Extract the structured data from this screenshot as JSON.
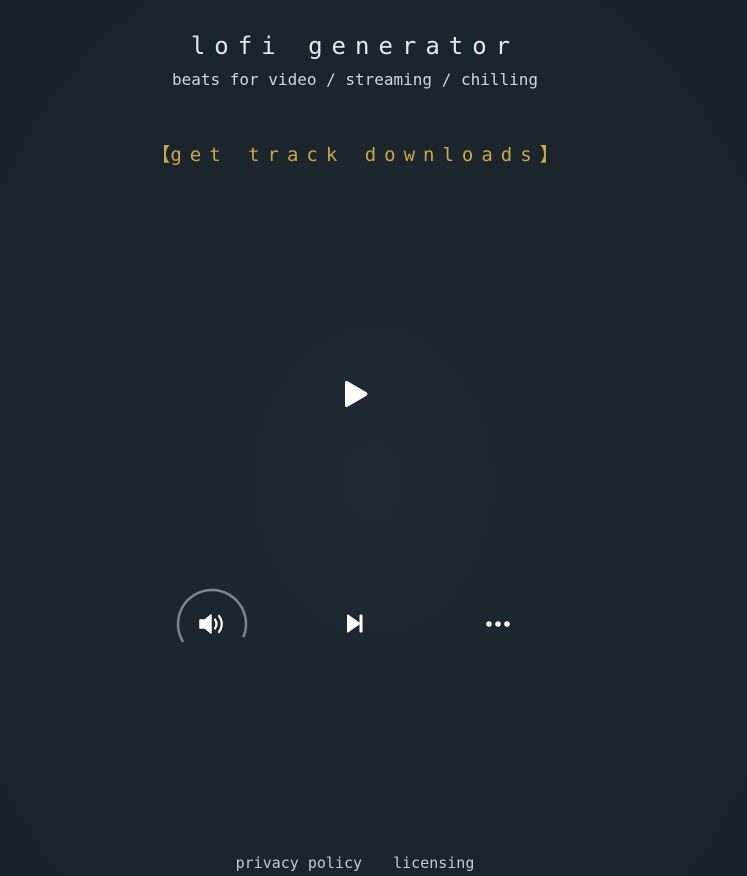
{
  "header": {
    "title": "lofi generator",
    "subtitle": "beats for video / streaming / chilling"
  },
  "downloads_link": {
    "open_bracket": "【",
    "label": "get track downloads",
    "close_bracket": "】"
  },
  "player": {
    "play_icon": "play-icon",
    "volume_icon": "volume-icon",
    "volume_level": 0.7,
    "skip_icon": "skip-next-icon",
    "more_icon": "more-dots-icon"
  },
  "footer": {
    "privacy_label": "privacy policy",
    "licensing_label": "licensing"
  },
  "colors": {
    "background": "#1b252c",
    "accent": "#c9a646",
    "text": "#d6dbdf",
    "icon": "#ffffff",
    "volume_ring": "#7d868d"
  }
}
